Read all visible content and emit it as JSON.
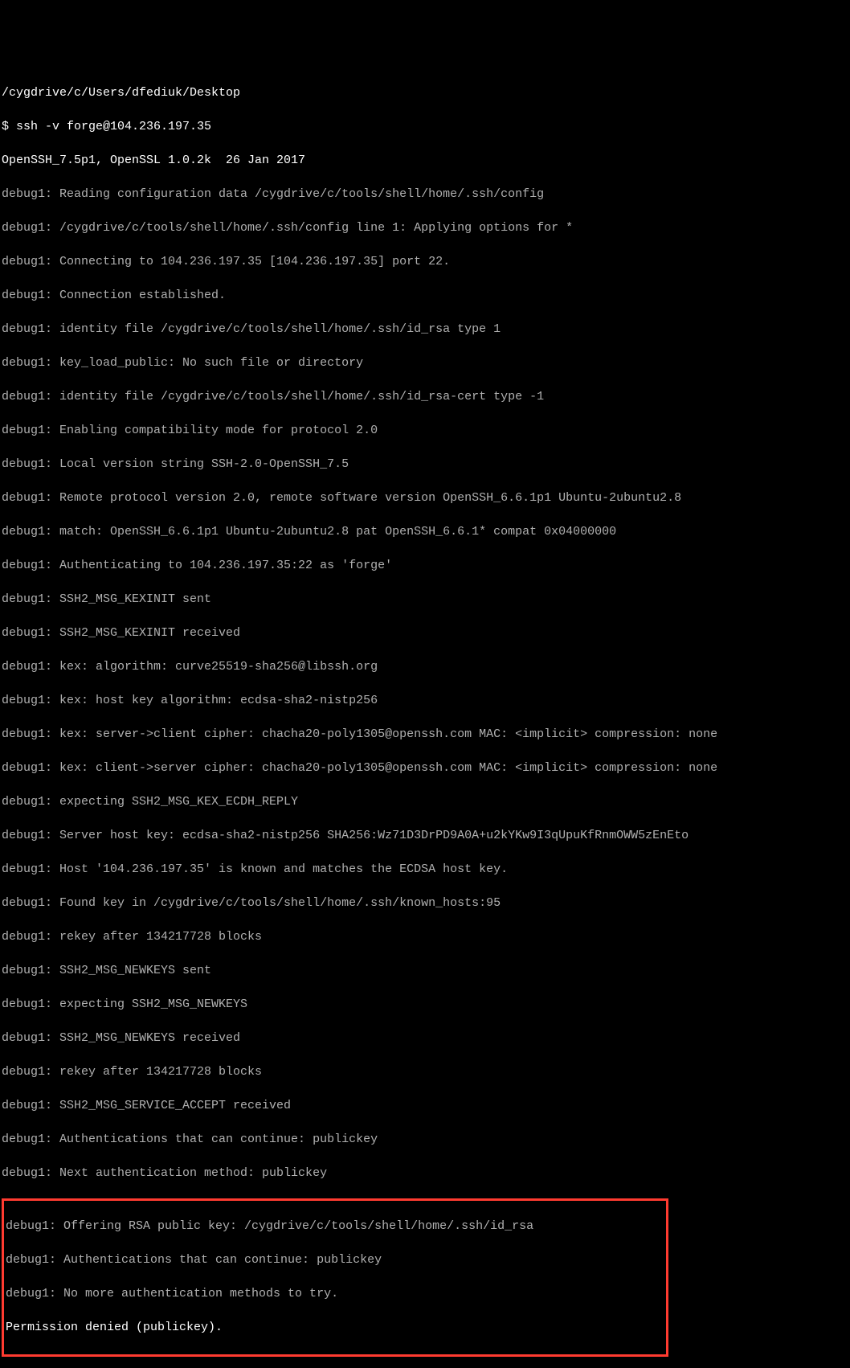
{
  "terminal": {
    "cwd": "/cygdrive/c/Users/dfediuk/Desktop",
    "prompt": "$ ",
    "command": "ssh -v forge@104.236.197.35",
    "version": "OpenSSH_7.5p1, OpenSSL 1.0.2k  26 Jan 2017",
    "lines": [
      "debug1: Reading configuration data /cygdrive/c/tools/shell/home/.ssh/config",
      "debug1: /cygdrive/c/tools/shell/home/.ssh/config line 1: Applying options for *",
      "debug1: Connecting to 104.236.197.35 [104.236.197.35] port 22.",
      "debug1: Connection established.",
      "debug1: identity file /cygdrive/c/tools/shell/home/.ssh/id_rsa type 1",
      "debug1: key_load_public: No such file or directory",
      "debug1: identity file /cygdrive/c/tools/shell/home/.ssh/id_rsa-cert type -1",
      "debug1: Enabling compatibility mode for protocol 2.0",
      "debug1: Local version string SSH-2.0-OpenSSH_7.5",
      "debug1: Remote protocol version 2.0, remote software version OpenSSH_6.6.1p1 Ubuntu-2ubuntu2.8",
      "debug1: match: OpenSSH_6.6.1p1 Ubuntu-2ubuntu2.8 pat OpenSSH_6.6.1* compat 0x04000000",
      "debug1: Authenticating to 104.236.197.35:22 as 'forge'",
      "debug1: SSH2_MSG_KEXINIT sent",
      "debug1: SSH2_MSG_KEXINIT received",
      "debug1: kex: algorithm: curve25519-sha256@libssh.org",
      "debug1: kex: host key algorithm: ecdsa-sha2-nistp256",
      "debug1: kex: server->client cipher: chacha20-poly1305@openssh.com MAC: <implicit> compression: none",
      "debug1: kex: client->server cipher: chacha20-poly1305@openssh.com MAC: <implicit> compression: none",
      "debug1: expecting SSH2_MSG_KEX_ECDH_REPLY",
      "debug1: Server host key: ecdsa-sha2-nistp256 SHA256:Wz71D3DrPD9A0A+u2kYKw9I3qUpuKfRnmOWW5zEnEto",
      "debug1: Host '104.236.197.35' is known and matches the ECDSA host key.",
      "debug1: Found key in /cygdrive/c/tools/shell/home/.ssh/known_hosts:95",
      "debug1: rekey after 134217728 blocks",
      "debug1: SSH2_MSG_NEWKEYS sent",
      "debug1: expecting SSH2_MSG_NEWKEYS",
      "debug1: SSH2_MSG_NEWKEYS received",
      "debug1: rekey after 134217728 blocks",
      "debug1: SSH2_MSG_SERVICE_ACCEPT received",
      "debug1: Authentications that can continue: publickey",
      "debug1: Next authentication method: publickey"
    ],
    "highlight": [
      "debug1: Offering RSA public key: /cygdrive/c/tools/shell/home/.ssh/id_rsa",
      "debug1: Authentications that can continue: publickey",
      "debug1: No more authentication methods to try.",
      "Permission denied (publickey)."
    ]
  }
}
